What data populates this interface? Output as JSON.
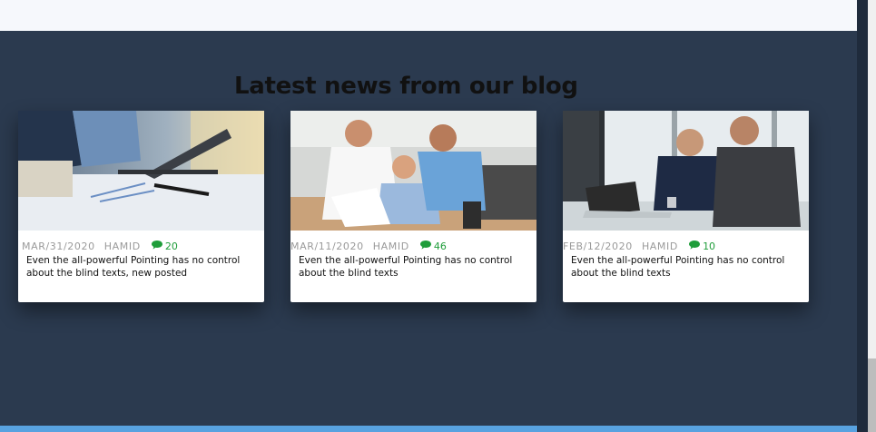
{
  "section": {
    "title": "Latest news from our blog"
  },
  "posts": [
    {
      "date": "MAR/31/2020",
      "author": "HAMID",
      "comments": "20",
      "excerpt": "Even the all-powerful Pointing has no control about the blind texts, new posted",
      "image_icon": "office-meeting-photo"
    },
    {
      "date": "MAR/11/2020",
      "author": "HAMID",
      "comments": "46",
      "excerpt": "Even the all-powerful Pointing has no control about the blind texts",
      "image_icon": "team-discussion-photo"
    },
    {
      "date": "FEB/12/2020",
      "author": "HAMID",
      "comments": "10",
      "excerpt": "Even the all-powerful Pointing has no control about the blind texts",
      "image_icon": "business-laptop-photo"
    }
  ],
  "colors": {
    "background": "#2b3a4f",
    "accent_green": "#1f9d3a",
    "bottom_bar": "#58a2e0",
    "meta_text": "#9a9a9a"
  }
}
